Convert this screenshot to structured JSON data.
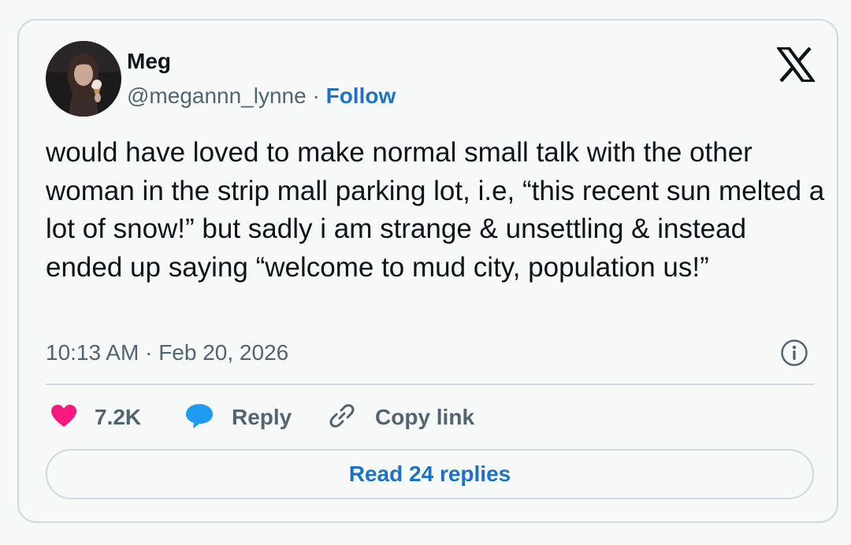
{
  "tweet": {
    "author_name": "Meg",
    "handle": "@megannn_lynne",
    "separator": "·",
    "follow_label": "Follow",
    "text": "would have loved to make normal small talk with the other woman in the strip mall parking lot, i.e, “this recent sun melted a lot of snow!” but sadly i am strange & unsettling & instead ended up saying “welcome to mud city, population us!”",
    "time": "10:13 AM",
    "date": "Feb 20, 2026"
  },
  "actions": {
    "like_count": "7.2K",
    "reply_label": "Reply",
    "copy_link_label": "Copy link",
    "read_replies_label": "Read 24 replies"
  },
  "icons": {
    "brand": "x-logo-icon",
    "info": "info-icon",
    "like": "heart-icon",
    "reply": "speech-bubble-icon",
    "copy": "link-icon"
  },
  "colors": {
    "accent_blue": "#1d72c2",
    "like_pink": "#f91880",
    "reply_blue": "#1d9bf0",
    "secondary_text": "#536471",
    "border": "#cfd9de",
    "background": "#f7f9f9"
  }
}
